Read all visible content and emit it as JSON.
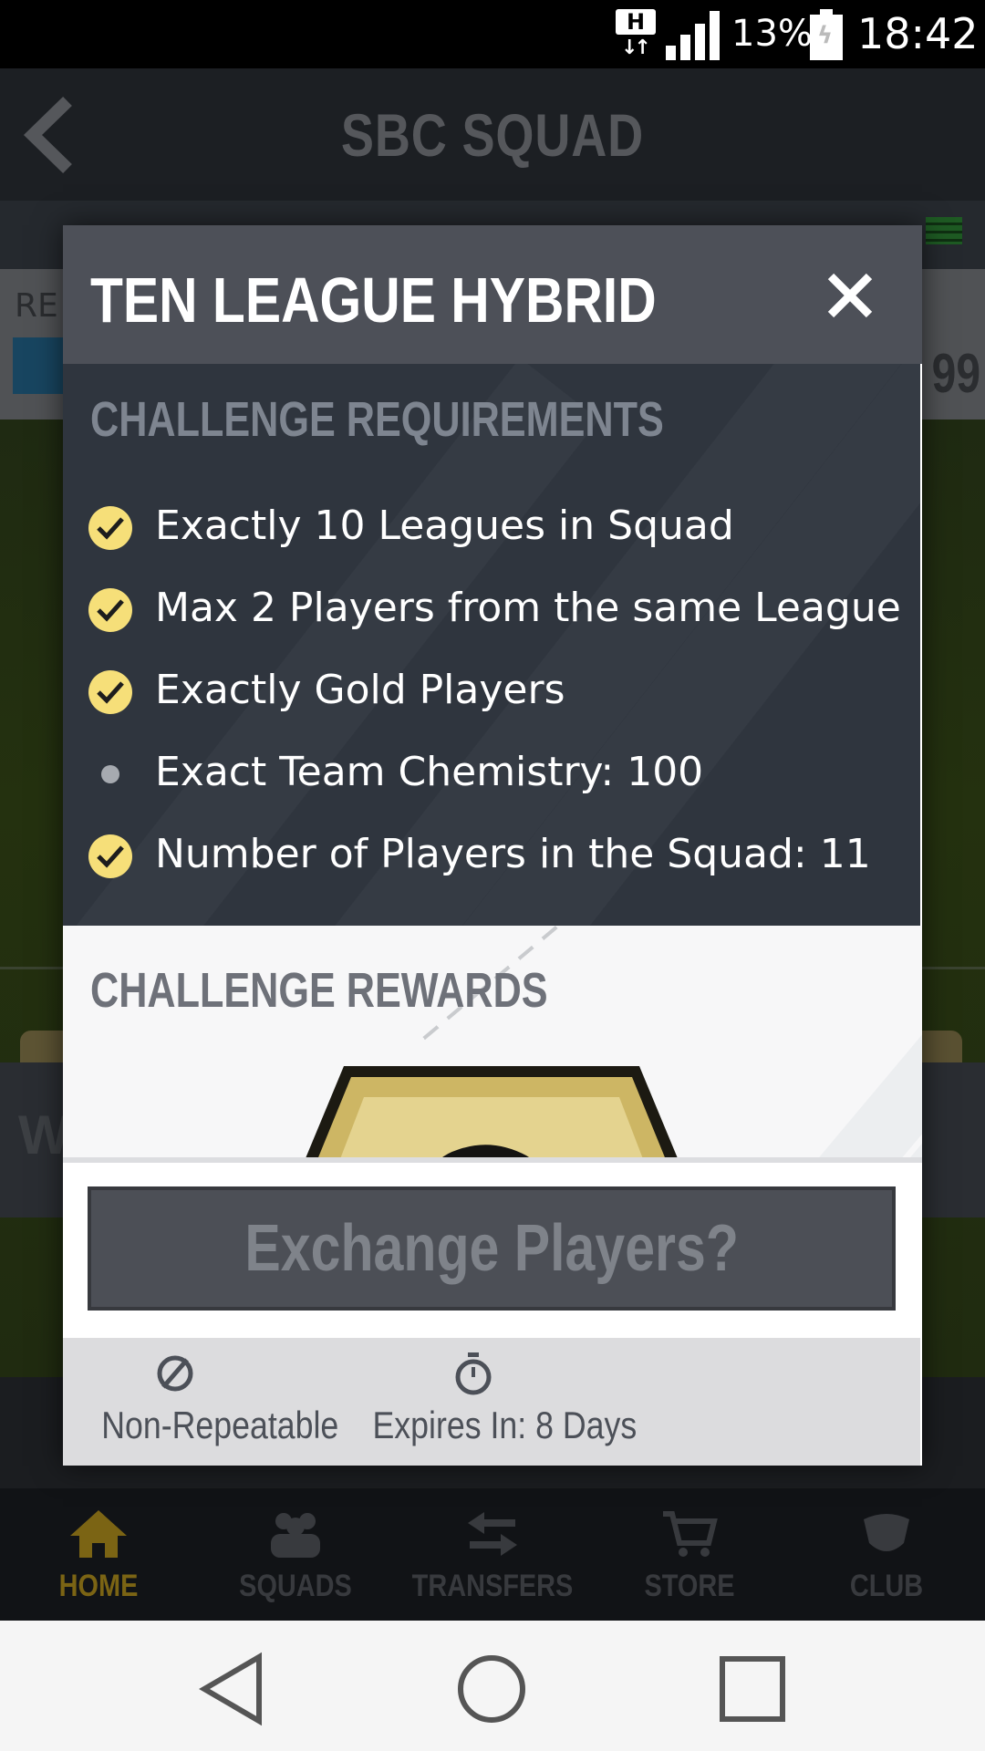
{
  "status_bar": {
    "network_type": "H",
    "battery_percent": "13%",
    "time": "18:42"
  },
  "background_app": {
    "header_title": "SBC SQUAD",
    "info_label": "RE",
    "rating": "99",
    "partial_text": "W",
    "nav": [
      {
        "label": "HOME",
        "icon": "home-icon",
        "active": true
      },
      {
        "label": "SQUADS",
        "icon": "squads-icon",
        "active": false
      },
      {
        "label": "TRANSFERS",
        "icon": "transfers-icon",
        "active": false
      },
      {
        "label": "STORE",
        "icon": "store-icon",
        "active": false
      },
      {
        "label": "CLUB",
        "icon": "club-icon",
        "active": false
      }
    ]
  },
  "modal": {
    "title": "TEN LEAGUE HYBRID",
    "close_icon": "close-icon",
    "requirements_title": "CHALLENGE REQUIREMENTS",
    "requirements": [
      {
        "text": "Exactly 10 Leagues in Squad",
        "met": true
      },
      {
        "text": "Max 2 Players from the same League",
        "met": true
      },
      {
        "text": "Exactly Gold Players",
        "met": true
      },
      {
        "text": "Exact Team Chemistry: 100",
        "met": false
      },
      {
        "text": "Number of Players in the Squad: 11",
        "met": true
      }
    ],
    "rewards_title": "CHALLENGE REWARDS",
    "exchange_button": "Exchange Players?",
    "footer": {
      "repeatable": "Non-Repeatable",
      "expires": "Expires In: 8 Days"
    }
  },
  "colors": {
    "accent_gold": "#f6df79",
    "modal_header": "#4d5058",
    "requirements_bg": "#2f353e",
    "nav_active": "#7b6414"
  }
}
